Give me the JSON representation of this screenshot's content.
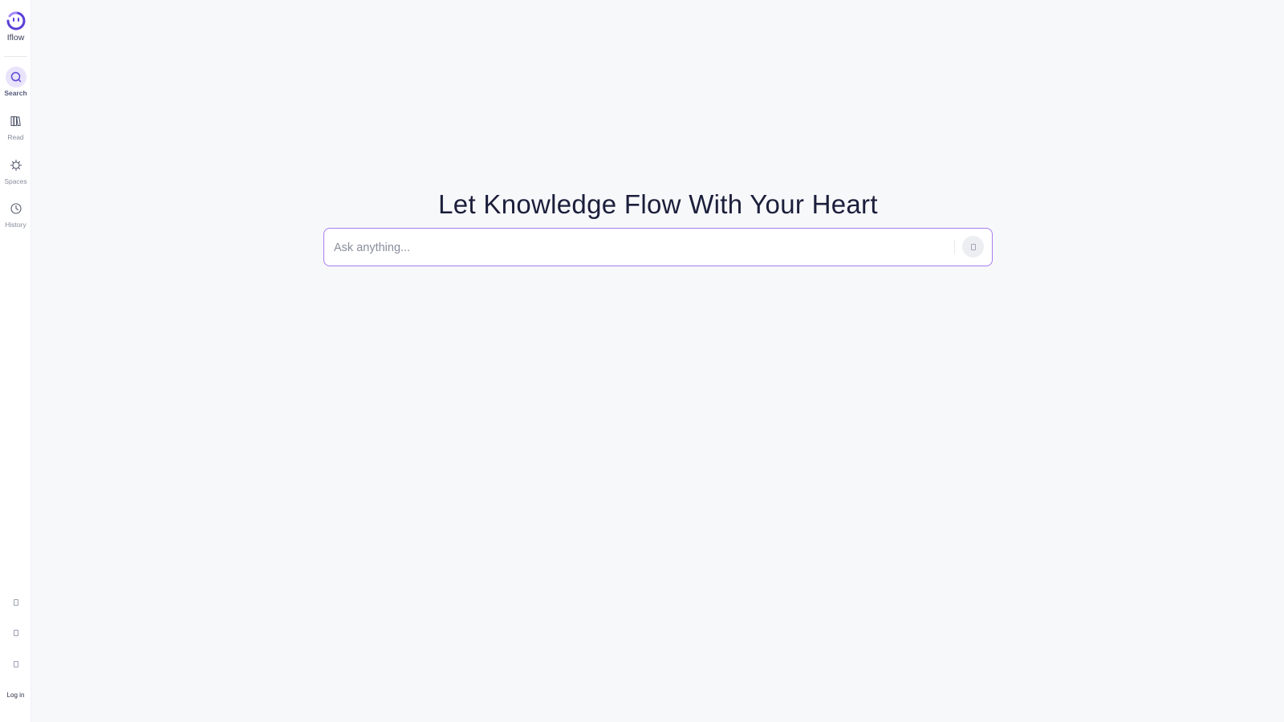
{
  "app": {
    "name": "Iflow"
  },
  "sidebar": {
    "items": [
      {
        "label": "Search",
        "icon": "search-icon",
        "active": true
      },
      {
        "label": "Read",
        "icon": "books-icon",
        "active": false
      },
      {
        "label": "Spaces",
        "icon": "spaces-icon",
        "active": false
      },
      {
        "label": "History",
        "icon": "clock-icon",
        "active": false
      }
    ],
    "utility_icons": [
      "glyph-icon",
      "glyph-icon",
      "glyph-icon"
    ],
    "login_label": "Log in"
  },
  "main": {
    "headline": "Let Knowledge Flow With Your Heart",
    "search": {
      "placeholder": "Ask anything...",
      "value": ""
    },
    "send_icon": "glyph-icon"
  },
  "colors": {
    "accent": "#6b4fe0",
    "accent_border": "#a67cf0",
    "active_nav_bg": "#e9e3fb",
    "background": "#f7f8fa",
    "text_dark": "#1b1f3b"
  }
}
